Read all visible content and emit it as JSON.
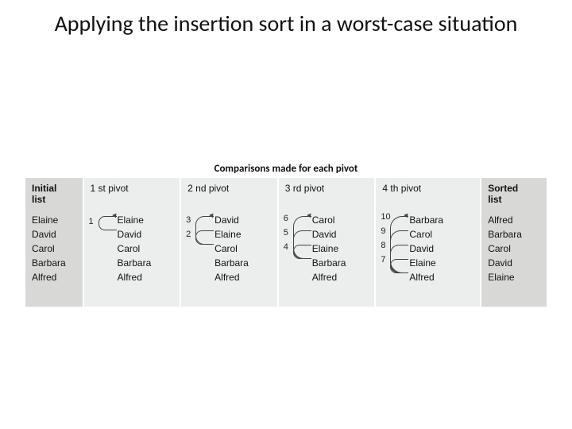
{
  "title": "Applying the insertion sort in a worst-case situation",
  "supertitle": "Comparisons made for each pivot",
  "headers": {
    "initial": "Initial\nlist",
    "p1": "1 st pivot",
    "p2": "2 nd pivot",
    "p3": "3 rd pivot",
    "p4": "4 th pivot",
    "sorted": "Sorted\nlist"
  },
  "columns": {
    "initial": [
      "Elaine",
      "David",
      "Carol",
      "Barbara",
      "Alfred"
    ],
    "sorted": [
      "Alfred",
      "Barbara",
      "Carol",
      "David",
      "Elaine"
    ],
    "p1": {
      "names": [
        "Elaine",
        "David",
        "Carol",
        "Barbara",
        "Alfred"
      ],
      "cmp": [
        "1"
      ]
    },
    "p2": {
      "names": [
        "David",
        "Elaine",
        "Carol",
        "Barbara",
        "Alfred"
      ],
      "cmp": [
        "3",
        "2"
      ]
    },
    "p3": {
      "names": [
        "Carol",
        "David",
        "Elaine",
        "Barbara",
        "Alfred"
      ],
      "cmp": [
        "6",
        "5",
        "4"
      ]
    },
    "p4": {
      "names": [
        "Barbara",
        "Carol",
        "David",
        "Elaine",
        "Alfred"
      ],
      "cmp": [
        "10",
        "9",
        "8",
        "7"
      ]
    }
  },
  "chart_data": {
    "type": "table",
    "title": "Comparisons made for each pivot",
    "categories": [
      "1st pivot",
      "2nd pivot",
      "3rd pivot",
      "4th pivot"
    ],
    "series": [
      {
        "name": "comparisons_this_pivot",
        "values": [
          1,
          2,
          3,
          4
        ]
      },
      {
        "name": "cumulative_comparison_indices",
        "values": [
          [
            1
          ],
          [
            2,
            3
          ],
          [
            4,
            5,
            6
          ],
          [
            7,
            8,
            9,
            10
          ]
        ]
      }
    ],
    "lists": {
      "initial": [
        "Elaine",
        "David",
        "Carol",
        "Barbara",
        "Alfred"
      ],
      "after_pivot_1": [
        "David",
        "Elaine",
        "Carol",
        "Barbara",
        "Alfred"
      ],
      "after_pivot_2": [
        "Carol",
        "David",
        "Elaine",
        "Barbara",
        "Alfred"
      ],
      "after_pivot_3": [
        "Barbara",
        "Carol",
        "David",
        "Elaine",
        "Alfred"
      ],
      "sorted": [
        "Alfred",
        "Barbara",
        "Carol",
        "David",
        "Elaine"
      ]
    }
  }
}
